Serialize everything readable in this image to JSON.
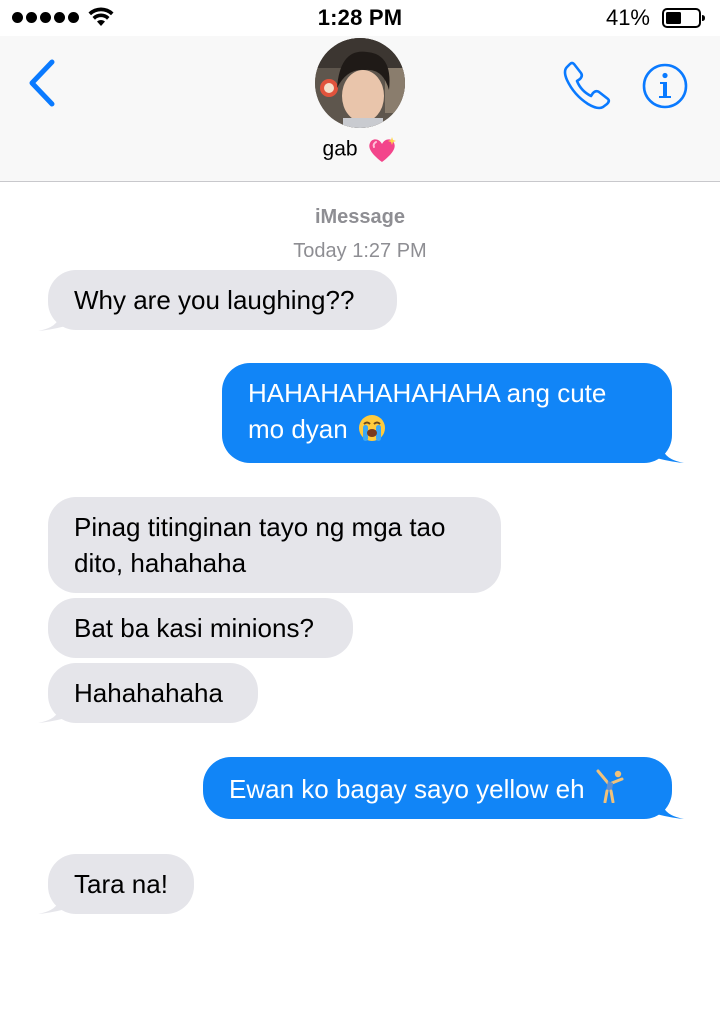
{
  "status_bar": {
    "time": "1:28 PM",
    "battery_percent": "41%",
    "signal_icon": "signal-dots-icon",
    "wifi_icon": "wifi-icon",
    "battery_icon": "battery-icon"
  },
  "header": {
    "contact_name": "gab",
    "back_icon": "chevron-left-icon",
    "phone_icon": "phone-icon",
    "info_icon": "info-icon",
    "heart_icon": "sparkling-heart-icon",
    "accent_color": "#0a7aff"
  },
  "conversation": {
    "service": "iMessage",
    "timestamp": "Today 1:27 PM",
    "messages": [
      {
        "from": "them",
        "text": "Why are you laughing??"
      },
      {
        "from": "me",
        "text": "HAHAHAHAHAHAHA ang cute mo dyan",
        "emoji": "loudly-crying-face-icon"
      },
      {
        "from": "them",
        "text": "Pinag titinginan tayo ng mga tao dito, hahahaha"
      },
      {
        "from": "them",
        "text": "Bat ba kasi minions?"
      },
      {
        "from": "them",
        "text": "Hahahahaha"
      },
      {
        "from": "me",
        "text": "Ewan ko bagay sayo yellow eh",
        "emoji": "cartwheel-icon"
      },
      {
        "from": "them",
        "text": "Tara na!"
      }
    ],
    "incoming_color": "#e5e5ea",
    "outgoing_color": "#1185f7"
  }
}
